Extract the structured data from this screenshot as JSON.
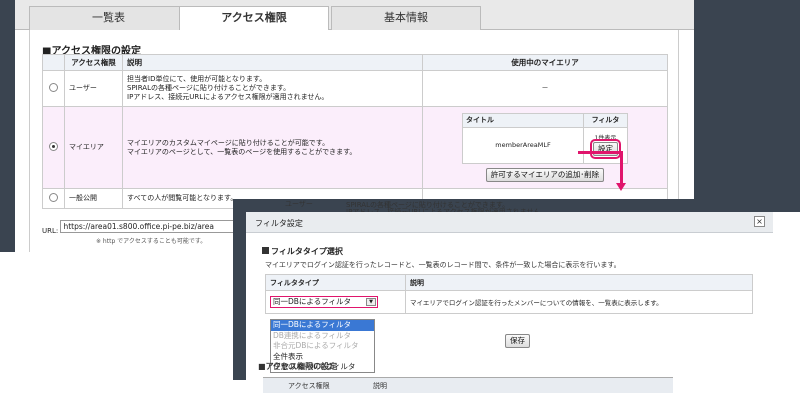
{
  "tabs": [
    {
      "label": "一覧表"
    },
    {
      "label": "アクセス権限"
    },
    {
      "label": "基本情報"
    }
  ],
  "section_title": "アクセス権限の設定",
  "table": {
    "headers": [
      "アクセス権限",
      "説明",
      "使用中のマイエリア"
    ],
    "rows": [
      {
        "name": "ユーザー",
        "desc": "担当者ID単位にて、使用が可能となります。\nSPIRALの各種ページに貼り付けることができます。\nIPアドレス、接続元URLによるアクセス権限が適用されません。",
        "area": "－"
      },
      {
        "name": "マイエリア",
        "desc": "マイエリアのカスタムマイページに貼り付けることが可能です。\nマイエリアのページとして、一覧表のページを使用することができます。"
      },
      {
        "name": "一般公開",
        "desc": "すべての人が閲覧可能となります。"
      }
    ],
    "inner_headers": [
      "タイトル",
      "フィルタ"
    ],
    "inner_title": "memberAreaMLF",
    "filter_status": "1件表示",
    "settings_button": "設定",
    "add_remove_button": "許可するマイエリアの追加･削除"
  },
  "url": {
    "label": "URL:",
    "value": "https://area01.s800.office.pi-pe.biz/area",
    "note": "※ http でアクセスすることも可能です。"
  },
  "dialog": {
    "title": "フィルタ設定",
    "close": "×",
    "section": "フィルタタイプ選択",
    "description": "マイエリアでログイン認証を行ったレコードと、一覧表のレコード間で、条件が一致した場合に表示を行います。",
    "headers": [
      "フィルタタイプ",
      "説明"
    ],
    "selected": "同一DBによるフィルタ",
    "row_desc": "マイエリアでログイン認証を行ったメンバーについての情報を、一覧表に表示します。",
    "save": "保存",
    "options": [
      {
        "label": "同一DBによるフィルタ",
        "state": "selected"
      },
      {
        "label": "DB連携によるフィルタ",
        "state": "disabled"
      },
      {
        "label": "非合元DBによるフィルタ",
        "state": "disabled"
      },
      {
        "label": "全件表示",
        "state": "normal"
      },
      {
        "label": "任意のルールでフィルタ",
        "state": "normal"
      }
    ]
  },
  "background_text": {
    "under_1": "SPIRALの各種ページに貼り付けることができます。",
    "under_2": "IPアドレス、接続元URLによるアクセス権限が適用されません。",
    "under_name": "ユーザー",
    "under_section": "アクセス権限の設定",
    "under_header": "アクセス権限",
    "under_header2": "説明"
  },
  "colors": {
    "accent": "#e0156c",
    "frame": "#3a4450",
    "header_bg": "#eef2f7",
    "highlight_row": "#fbeefb",
    "selected": "#3a78d4"
  }
}
